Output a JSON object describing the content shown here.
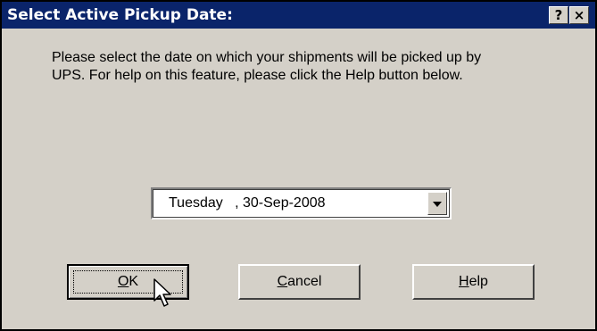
{
  "dialog": {
    "title": "Select Active Pickup Date:",
    "help_glyph": "?",
    "close_glyph": "×"
  },
  "message": {
    "line1": "Please select the date on which your shipments will be picked up by",
    "line2": "UPS.  For help on this feature, please click the Help button below."
  },
  "date_select": {
    "value": "Tuesday   , 30-Sep-2008"
  },
  "buttons": {
    "ok": {
      "mnemonic": "O",
      "rest": "K"
    },
    "cancel": {
      "mnemonic": "C",
      "rest": "ancel"
    },
    "help": {
      "mnemonic": "H",
      "rest": "elp"
    }
  },
  "icons": {
    "help": "question-mark-icon",
    "close": "close-icon",
    "dropdown": "chevron-down-icon",
    "cursor": "mouse-pointer-icon"
  },
  "colors": {
    "titlebar": "#0a246a",
    "dialog_bg": "#d4d0c8"
  }
}
